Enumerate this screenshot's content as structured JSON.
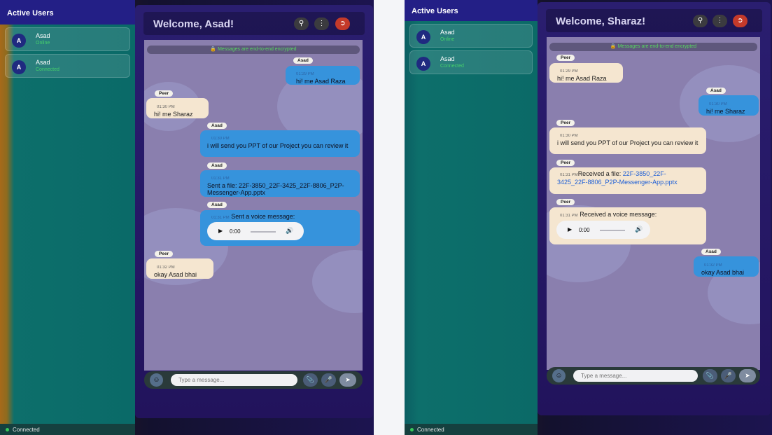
{
  "left": {
    "sidebar": {
      "title": "Active Users",
      "users": [
        {
          "initial": "A",
          "name": "Asad",
          "status": "Online"
        },
        {
          "initial": "A",
          "name": "Asad",
          "status": "Connected"
        }
      ],
      "footer": "Connected"
    },
    "header": {
      "title": "Welcome, Asad!"
    },
    "banner": "Messages are end-to-end encrypted",
    "messages": [
      {
        "sender": "Asad",
        "time": "01:29 PM",
        "text": "hi! me Asad Raza"
      },
      {
        "sender": "Peer",
        "time": "01:30 PM",
        "text": "hi! me Sharaz"
      },
      {
        "sender": "Asad",
        "time": "01:30 PM",
        "text": "i will send you PPT of our Project you can review it"
      },
      {
        "sender": "Asad",
        "time": "01:31 PM",
        "text": "Sent a file: 22F-3850_22F-3425_22F-8806_P2P-Messenger-App.pptx"
      },
      {
        "sender": "Asad",
        "time": "01:31 PM",
        "text": "Sent a voice message:",
        "audio_time": "0:00"
      },
      {
        "sender": "Peer",
        "time": "01:32 PM",
        "text": "okay Asad bhai"
      }
    ],
    "composer": {
      "placeholder": "Type a message..."
    }
  },
  "right": {
    "sidebar": {
      "title": "Active Users",
      "users": [
        {
          "initial": "A",
          "name": "Asad",
          "status": "Online"
        },
        {
          "initial": "A",
          "name": "Asad",
          "status": "Connected"
        }
      ],
      "footer": "Connected"
    },
    "header": {
      "title": "Welcome, Sharaz!"
    },
    "banner": "Messages are end-to-end encrypted",
    "messages": [
      {
        "sender": "Peer",
        "time": "01:29 PM",
        "text": "hi! me Asad Raza"
      },
      {
        "sender": "Asad",
        "time": "01:30 PM",
        "text": "hi! me Sharaz"
      },
      {
        "sender": "Peer",
        "time": "01:30 PM",
        "text": "i will send you PPT of our Project you can review it"
      },
      {
        "sender": "Peer",
        "time": "01:31 PM",
        "text": "Received a file: ",
        "file": "22F-3850_22F-3425_22F-8806_P2P-Messenger-App.pptx"
      },
      {
        "sender": "Peer",
        "time": "01:31 PM",
        "text": "Received a voice message:",
        "audio_time": "0:00"
      },
      {
        "sender": "Asad",
        "time": "01:32 PM",
        "text": "okay Asad bhai"
      }
    ],
    "composer": {
      "placeholder": "Type a message..."
    }
  },
  "icons": {
    "search": "search-icon",
    "menu": "more-vertical-icon",
    "logout": "logout-icon",
    "emoji": "emoji-icon",
    "attach": "paperclip-icon",
    "mic": "microphone-icon",
    "send": "send-icon",
    "lock": "lock-icon",
    "play": "play-icon",
    "volume": "volume-icon"
  },
  "colors": {
    "accent": "#231f86",
    "outgoing": "#3693dc",
    "incoming": "#f5e6d0",
    "online": "#46d06c"
  }
}
